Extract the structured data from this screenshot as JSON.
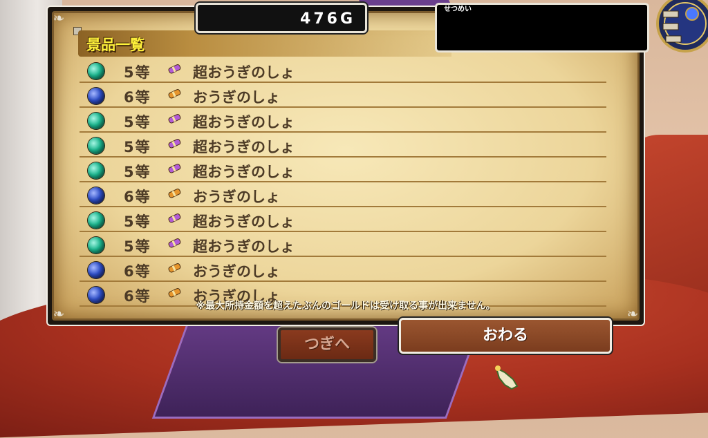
{
  "gold": "476G",
  "description_label": "せつめい",
  "prize_list": {
    "title": "景品一覧",
    "rows": [
      {
        "orb": "green",
        "rank": "5等",
        "item": "超おうぎのしょ",
        "icon": "purple-scroll-icon"
      },
      {
        "orb": "blue",
        "rank": "6等",
        "item": "おうぎのしょ",
        "icon": "orange-scroll-icon"
      },
      {
        "orb": "green",
        "rank": "5等",
        "item": "超おうぎのしょ",
        "icon": "purple-scroll-icon"
      },
      {
        "orb": "green",
        "rank": "5等",
        "item": "超おうぎのしょ",
        "icon": "purple-scroll-icon"
      },
      {
        "orb": "green",
        "rank": "5等",
        "item": "超おうぎのしょ",
        "icon": "purple-scroll-icon"
      },
      {
        "orb": "blue",
        "rank": "6等",
        "item": "おうぎのしょ",
        "icon": "orange-scroll-icon"
      },
      {
        "orb": "green",
        "rank": "5等",
        "item": "超おうぎのしょ",
        "icon": "purple-scroll-icon"
      },
      {
        "orb": "green",
        "rank": "5等",
        "item": "超おうぎのしょ",
        "icon": "purple-scroll-icon"
      },
      {
        "orb": "blue",
        "rank": "6等",
        "item": "おうぎのしょ",
        "icon": "orange-scroll-icon"
      },
      {
        "orb": "blue",
        "rank": "6等",
        "item": "おうぎのしょ",
        "icon": "orange-scroll-icon"
      }
    ],
    "note": "※最大所持金額を超えたぶんのゴールドは受け取る事が出来ません。"
  },
  "buttons": {
    "next": "つぎへ",
    "end": "おわる"
  },
  "colors": {
    "title_yellow": "#fff23b",
    "text_brown": "#4d3b26",
    "orb_green": "#1cb58e",
    "orb_blue": "#2f4fc7",
    "scroll_purple": "#b35cd6",
    "scroll_orange": "#e6962e"
  }
}
